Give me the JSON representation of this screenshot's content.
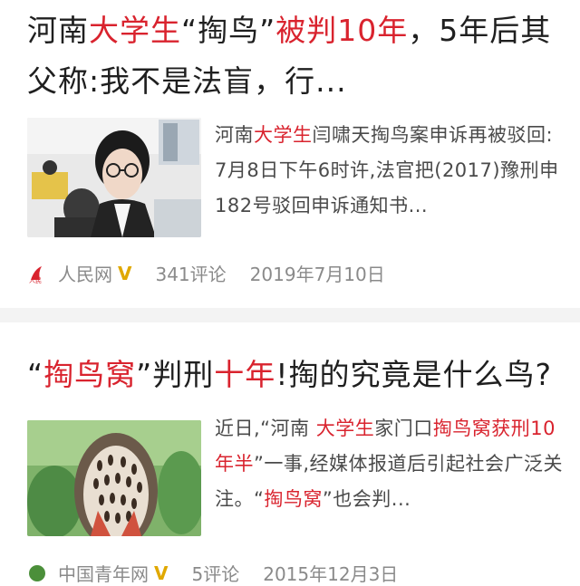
{
  "articles": [
    {
      "title_parts": [
        "河南",
        "大学生",
        "“掏鸟”",
        "被判10年",
        "，5年后其父称:我不是法盲，行..."
      ],
      "summary_parts": [
        "河南",
        "大学生",
        "闫啸天掏鸟案申诉再被驳回: 7月8日下午6时许,法官把(2017)豫刑申182号驳回申诉通知书..."
      ],
      "source": "人民网",
      "verified_mark": "V",
      "comments": "341评论",
      "date": "2019年7月10日",
      "thumbnail_icon": "student-photo"
    },
    {
      "title_parts": [
        "“",
        "掏鸟窝",
        "”判刑",
        "十年",
        "!掏的究竟是什么鸟?"
      ],
      "summary_parts": [
        "近日,“河南 ",
        "大学生",
        "家门口",
        "掏鸟窝获刑10年半",
        "”一事,经媒体报道后引起社会广泛关注。“",
        "掏鸟窝",
        "”也会判..."
      ],
      "source": "中国青年网",
      "verified_mark": "V",
      "comments": "5评论",
      "date": "2015年12月3日",
      "thumbnail_icon": "falcon-photo"
    }
  ],
  "colors": {
    "highlight": "#d9232e",
    "verified": "#e0a800",
    "divider": "#f3f3f3"
  }
}
